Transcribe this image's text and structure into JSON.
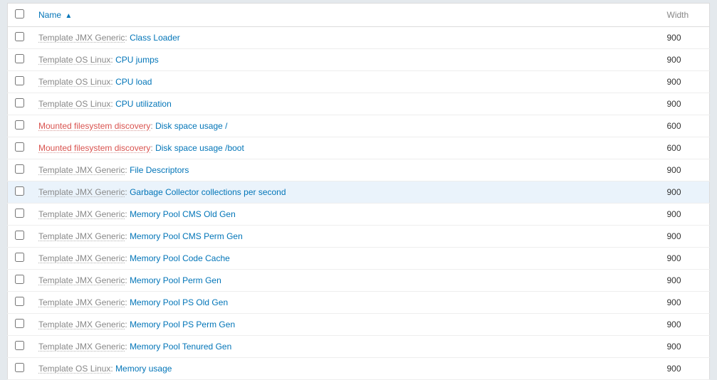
{
  "columns": {
    "name": "Name",
    "width": "Width"
  },
  "rows": [
    {
      "prefix": "Template JMX Generic",
      "prefixWarn": false,
      "item": "Class Loader",
      "width": "900",
      "highlight": false
    },
    {
      "prefix": "Template OS Linux",
      "prefixWarn": false,
      "item": "CPU jumps",
      "width": "900",
      "highlight": false
    },
    {
      "prefix": "Template OS Linux",
      "prefixWarn": false,
      "item": "CPU load",
      "width": "900",
      "highlight": false
    },
    {
      "prefix": "Template OS Linux",
      "prefixWarn": false,
      "item": "CPU utilization",
      "width": "900",
      "highlight": false
    },
    {
      "prefix": "Mounted filesystem discovery",
      "prefixWarn": true,
      "item": "Disk space usage /",
      "width": "600",
      "highlight": false
    },
    {
      "prefix": "Mounted filesystem discovery",
      "prefixWarn": true,
      "item": "Disk space usage /boot",
      "width": "600",
      "highlight": false
    },
    {
      "prefix": "Template JMX Generic",
      "prefixWarn": false,
      "item": "File Descriptors",
      "width": "900",
      "highlight": false
    },
    {
      "prefix": "Template JMX Generic",
      "prefixWarn": false,
      "item": "Garbage Collector collections per second",
      "width": "900",
      "highlight": true
    },
    {
      "prefix": "Template JMX Generic",
      "prefixWarn": false,
      "item": "Memory Pool CMS Old Gen",
      "width": "900",
      "highlight": false
    },
    {
      "prefix": "Template JMX Generic",
      "prefixWarn": false,
      "item": "Memory Pool CMS Perm Gen",
      "width": "900",
      "highlight": false
    },
    {
      "prefix": "Template JMX Generic",
      "prefixWarn": false,
      "item": "Memory Pool Code Cache",
      "width": "900",
      "highlight": false
    },
    {
      "prefix": "Template JMX Generic",
      "prefixWarn": false,
      "item": "Memory Pool Perm Gen",
      "width": "900",
      "highlight": false
    },
    {
      "prefix": "Template JMX Generic",
      "prefixWarn": false,
      "item": "Memory Pool PS Old Gen",
      "width": "900",
      "highlight": false
    },
    {
      "prefix": "Template JMX Generic",
      "prefixWarn": false,
      "item": "Memory Pool PS Perm Gen",
      "width": "900",
      "highlight": false
    },
    {
      "prefix": "Template JMX Generic",
      "prefixWarn": false,
      "item": "Memory Pool Tenured Gen",
      "width": "900",
      "highlight": false
    },
    {
      "prefix": "Template OS Linux",
      "prefixWarn": false,
      "item": "Memory usage",
      "width": "900",
      "highlight": false
    }
  ]
}
